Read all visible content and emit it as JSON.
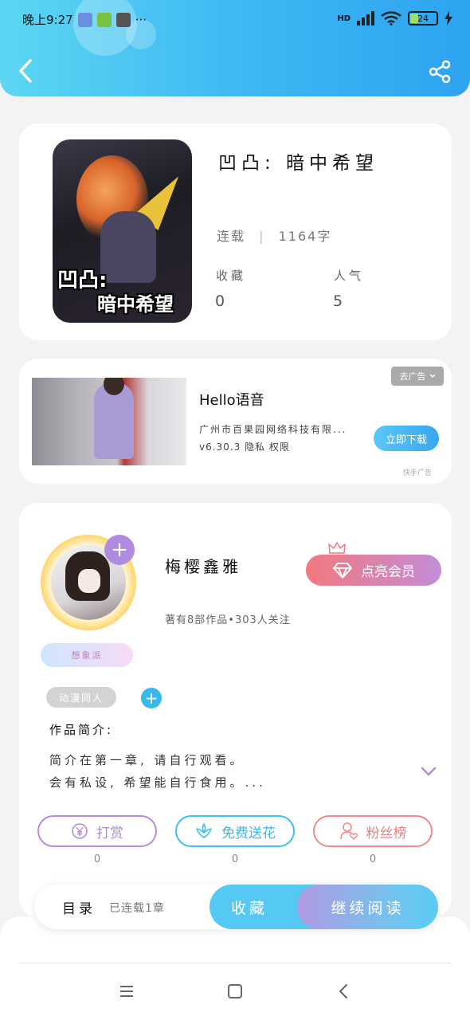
{
  "status_bar": {
    "time": "晚上9:27",
    "more": "···",
    "network": "HD",
    "battery": "24"
  },
  "icons": {
    "back": "back-arrow-icon",
    "share": "share-icon",
    "crown": "crown-icon",
    "diamond": "diamond-icon",
    "yen": "yen-coin-icon",
    "flower": "flower-icon",
    "fans": "person-heart-icon",
    "expand": "chevron-down-icon"
  },
  "book": {
    "cover_title_line1": "凹凸:",
    "cover_title_line2": "暗中希望",
    "title": "凹凸: 暗中希望",
    "status": "连载",
    "separator": "|",
    "word_count": "1164字",
    "favorites_label": "收藏",
    "favorites_value": "0",
    "popularity_label": "人气",
    "popularity_value": "5"
  },
  "ad": {
    "badge": "去广告",
    "title": "Hello语音",
    "company": "广州市百果园网络科技有限...",
    "version": "v6.30.3 隐私 权限",
    "download_label": "立即下载",
    "source": "快手广告"
  },
  "author": {
    "name": "梅樱鑫雅",
    "badge": "想象派",
    "meta": "著有8部作品•303人关注",
    "vip_label": "点亮会员",
    "avatar_plus": "+",
    "tag": "动漫同人",
    "tag_add": "+",
    "intro_label": "作品简介:",
    "intro_line1": "简介在第一章, 请自行观看。",
    "intro_line2": "会有私设, 希望能自行食用。...",
    "actions": [
      {
        "label": "打赏",
        "count": "0"
      },
      {
        "label": "免费送花",
        "count": "0"
      },
      {
        "label": "粉丝榜",
        "count": "0"
      }
    ]
  },
  "bottom_bar": {
    "toc_label": "目录",
    "toc_status": "已连载1章",
    "favorite_label": "收藏",
    "continue_label": "继续阅读"
  },
  "colors": {
    "header": "#3db6f3",
    "reward": "#b48ce0",
    "flower": "#3cc0ec",
    "fans": "#f08a8a",
    "vip": "#f2797e"
  }
}
